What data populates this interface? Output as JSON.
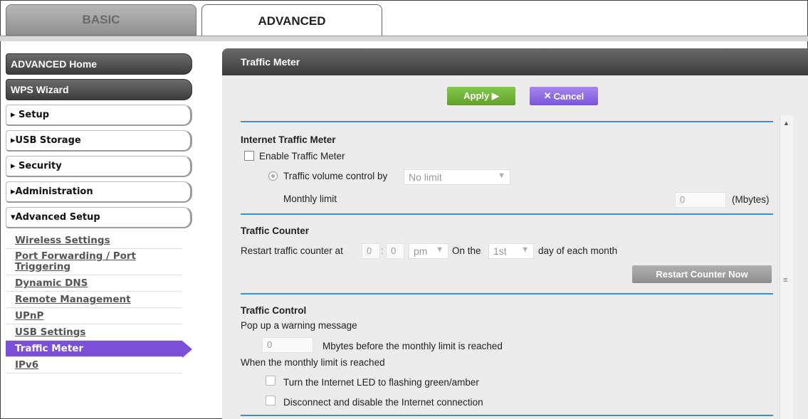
{
  "tabs": {
    "basic": "BASIC",
    "advanced": "ADVANCED"
  },
  "sidebar": {
    "buttons": [
      {
        "label": "ADVANCED Home"
      },
      {
        "label": "WPS Wizard"
      },
      {
        "label": "▸ Setup"
      },
      {
        "label": "▸USB Storage"
      },
      {
        "label": "▸ Security"
      },
      {
        "label": "▸Administration"
      },
      {
        "label": "▾Advanced Setup"
      }
    ],
    "subitems": [
      {
        "label": "Wireless Settings"
      },
      {
        "label": "Port Forwarding / Port Triggering"
      },
      {
        "label": "Dynamic DNS"
      },
      {
        "label": "Remote Management"
      },
      {
        "label": "UPnP"
      },
      {
        "label": "USB Settings"
      },
      {
        "label": "Traffic Meter"
      },
      {
        "label": "IPv6"
      }
    ]
  },
  "main": {
    "title": "Traffic Meter",
    "apply": "Apply ▶",
    "cancel": "Cancel",
    "cancel_icon": "✕",
    "itm": {
      "heading": "Internet Traffic Meter",
      "enable_label": "Enable Traffic Meter",
      "volume_label": "Traffic volume control by",
      "volume_value": "No limit",
      "monthly_label": "Monthly limit",
      "monthly_value": "0",
      "monthly_unit": "(Mbytes)"
    },
    "counter": {
      "heading": "Traffic Counter",
      "restart_label": "Restart traffic counter at",
      "hour": "0",
      "colon": ":",
      "minute": "0",
      "ampm": "pm",
      "on_the": "On the",
      "day": "1st",
      "day_suffix": "day of each month",
      "restart_button": "Restart Counter Now"
    },
    "control": {
      "heading": "Traffic Control",
      "popup_label": "Pop up a warning message",
      "mbytes_value": "0",
      "mbytes_label": "Mbytes before the monthly limit is reached",
      "when_label": "When the monthly limit is reached",
      "led_label": "Turn the Internet LED to flashing green/amber",
      "disconnect_label": "Disconnect and disable the Internet connection"
    }
  }
}
